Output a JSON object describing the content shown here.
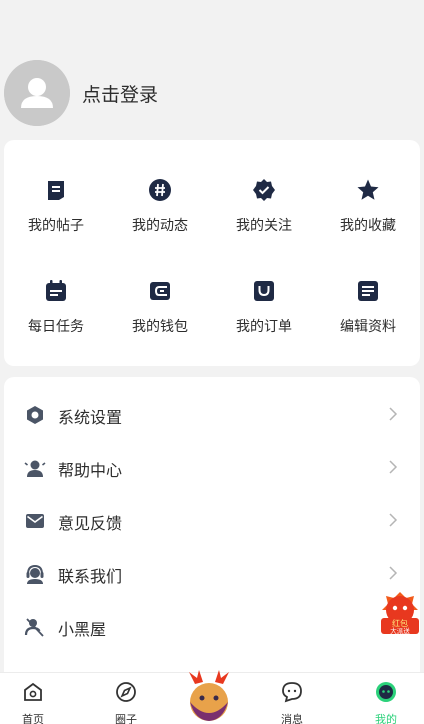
{
  "profile": {
    "login_label": "点击登录"
  },
  "grid": {
    "row1": [
      {
        "label": "我的帖子",
        "icon": "posts-icon"
      },
      {
        "label": "我的动态",
        "icon": "hashtag-icon"
      },
      {
        "label": "我的关注",
        "icon": "verified-badge-icon"
      },
      {
        "label": "我的收藏",
        "icon": "star-icon"
      }
    ],
    "row2": [
      {
        "label": "每日任务",
        "icon": "calendar-task-icon"
      },
      {
        "label": "我的钱包",
        "icon": "wallet-icon"
      },
      {
        "label": "我的订单",
        "icon": "shopping-bag-icon"
      },
      {
        "label": "编辑资料",
        "icon": "edit-profile-icon"
      }
    ]
  },
  "menu": [
    {
      "label": "系统设置",
      "icon": "settings-icon"
    },
    {
      "label": "帮助中心",
      "icon": "help-icon"
    },
    {
      "label": "意见反馈",
      "icon": "mail-icon"
    },
    {
      "label": "联系我们",
      "icon": "support-agent-icon"
    },
    {
      "label": "小黑屋",
      "icon": "blocked-icon"
    }
  ],
  "float_badge": {
    "line1": "红包",
    "line2": "大派送"
  },
  "tabbar": [
    {
      "label": "首页",
      "icon": "home-icon"
    },
    {
      "label": "圈子",
      "icon": "compass-icon"
    },
    {
      "label": "消息",
      "icon": "message-icon"
    },
    {
      "label": "我的",
      "icon": "profile-face-icon"
    }
  ],
  "colors": {
    "accent": "#2bd17a",
    "icon_dark": "#1f2a44",
    "background": "#f2f2f2"
  }
}
